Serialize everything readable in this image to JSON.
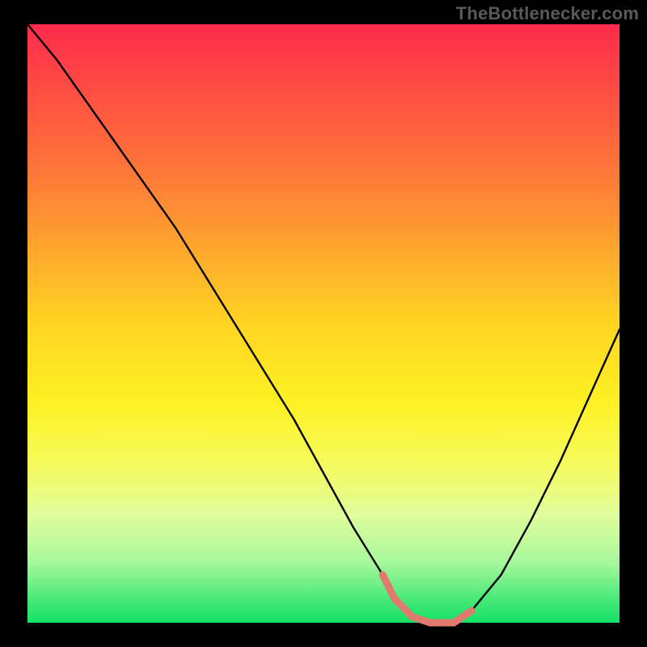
{
  "watermark": {
    "text": "TheBottlenecker.com"
  },
  "colors": {
    "frame": "#000000",
    "plot_border": "#000000",
    "curve": "#000000",
    "curve_highlight": "#E07A6F",
    "watermark": "#595959"
  },
  "chart_data": {
    "type": "line",
    "title": "",
    "xlabel": "",
    "ylabel": "",
    "xlim": [
      0,
      100
    ],
    "ylim": [
      0,
      100
    ],
    "gradient_stops": [
      {
        "offset": 0.0,
        "color": "#FE2B4B"
      },
      {
        "offset": 0.25,
        "color": "#FE7839"
      },
      {
        "offset": 0.5,
        "color": "#FED422"
      },
      {
        "offset": 0.63,
        "color": "#FDF123"
      },
      {
        "offset": 0.73,
        "color": "#F7FB5A"
      },
      {
        "offset": 0.82,
        "color": "#E0FC9B"
      },
      {
        "offset": 0.9,
        "color": "#A6F89D"
      },
      {
        "offset": 0.96,
        "color": "#49E977"
      },
      {
        "offset": 1.0,
        "color": "#14E169"
      }
    ],
    "series": [
      {
        "name": "bottleneck-curve",
        "x": [
          0,
          5,
          10,
          15,
          20,
          25,
          30,
          35,
          40,
          45,
          50,
          55,
          60,
          62,
          65,
          68,
          70,
          72,
          75,
          80,
          85,
          90,
          95,
          100
        ],
        "y": [
          100,
          94,
          87,
          80,
          73,
          66,
          58,
          50,
          42,
          34,
          25,
          16,
          8,
          4,
          1,
          0,
          0,
          0,
          2,
          8,
          17,
          27,
          38,
          49
        ]
      }
    ],
    "highlight_range_x": [
      59,
      75
    ]
  }
}
